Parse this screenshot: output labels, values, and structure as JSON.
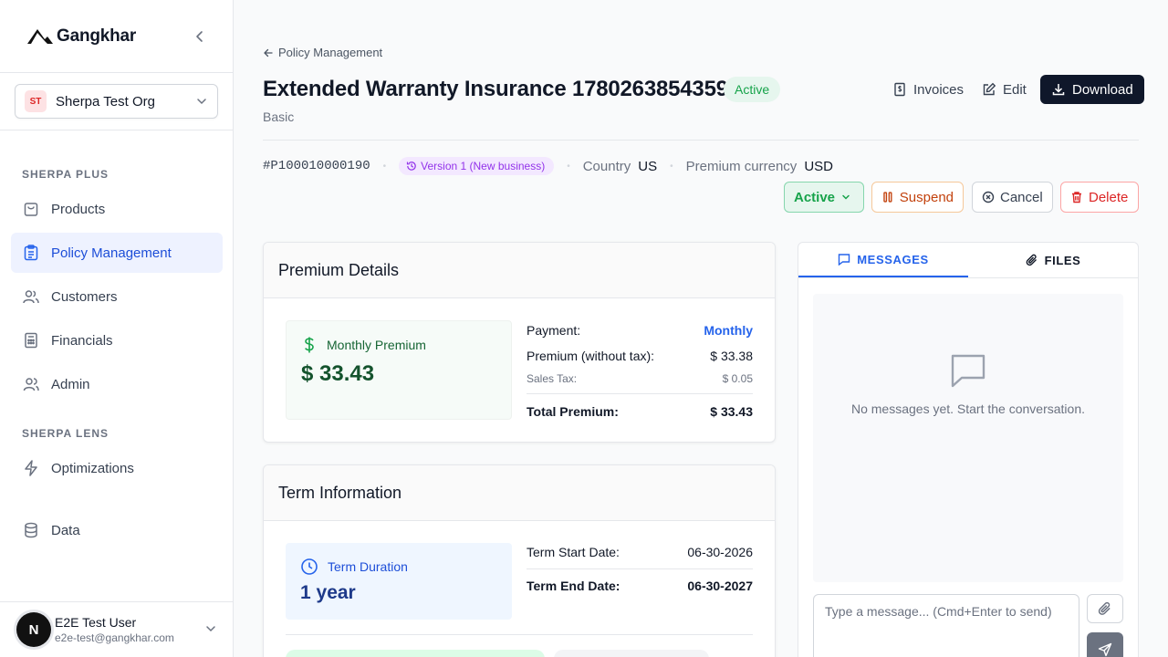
{
  "app": {
    "brand": "Gangkhar"
  },
  "sidebar": {
    "org": {
      "initials": "ST",
      "name": "Sherpa Test Org"
    },
    "sections": [
      "SHERPA PLUS",
      "SHERPA LENS"
    ],
    "items": [
      {
        "label": "Products",
        "icon": "shopping-bag-icon"
      },
      {
        "label": "Policy Management",
        "icon": "clipboard-list-icon",
        "active": true
      },
      {
        "label": "Customers",
        "icon": "users-icon"
      },
      {
        "label": "Financials",
        "icon": "calculator-icon"
      },
      {
        "label": "Admin",
        "icon": "user-cog-icon"
      },
      {
        "label": "Optimizations",
        "icon": "zap-icon"
      },
      {
        "label": "Data",
        "icon": "database-icon"
      }
    ],
    "user": {
      "initial": "N",
      "name": "E2E Test User",
      "email": "e2e-test@gangkhar.com"
    }
  },
  "page": {
    "breadcrumb": "Policy Management",
    "title": "Extended Warranty Insurance 1780263854359",
    "status": "Active",
    "subtitle": "Basic",
    "actions": {
      "invoices": "Invoices",
      "edit": "Edit",
      "download": "Download"
    },
    "meta": {
      "policy_number": "#P100010000190",
      "version": "Version 1 (New business)",
      "country_label": "Country",
      "country_value": "US",
      "currency_label": "Premium currency",
      "currency_value": "USD"
    },
    "status_actions": {
      "status": "Active",
      "suspend": "Suspend",
      "cancel": "Cancel",
      "delete": "Delete"
    }
  },
  "premium": {
    "heading": "Premium Details",
    "tile_label": "Monthly Premium",
    "tile_value": "$ 33.43",
    "payment_label": "Payment:",
    "payment_value": "Monthly",
    "premium_label": "Premium (without tax):",
    "premium_value": "$ 33.38",
    "tax_label": "Sales Tax:",
    "tax_value": "$ 0.05",
    "total_label": "Total Premium:",
    "total_value": "$ 33.43"
  },
  "term": {
    "heading": "Term Information",
    "tile_label": "Term Duration",
    "tile_value": "1 year",
    "start_label": "Term Start Date:",
    "start_value": "06-30-2026",
    "end_label": "Term End Date:",
    "end_value": "06-30-2027"
  },
  "panel": {
    "tabs": {
      "messages": "MESSAGES",
      "files": "FILES"
    },
    "empty_text": "No messages yet. Start the conversation.",
    "input_placeholder": "Type a message... (Cmd+Enter to send)"
  },
  "colors": {
    "accent": "#2563eb",
    "success": "#16a34a",
    "danger": "#dc2626",
    "warning": "#c2410c",
    "dark": "#0f172a"
  }
}
